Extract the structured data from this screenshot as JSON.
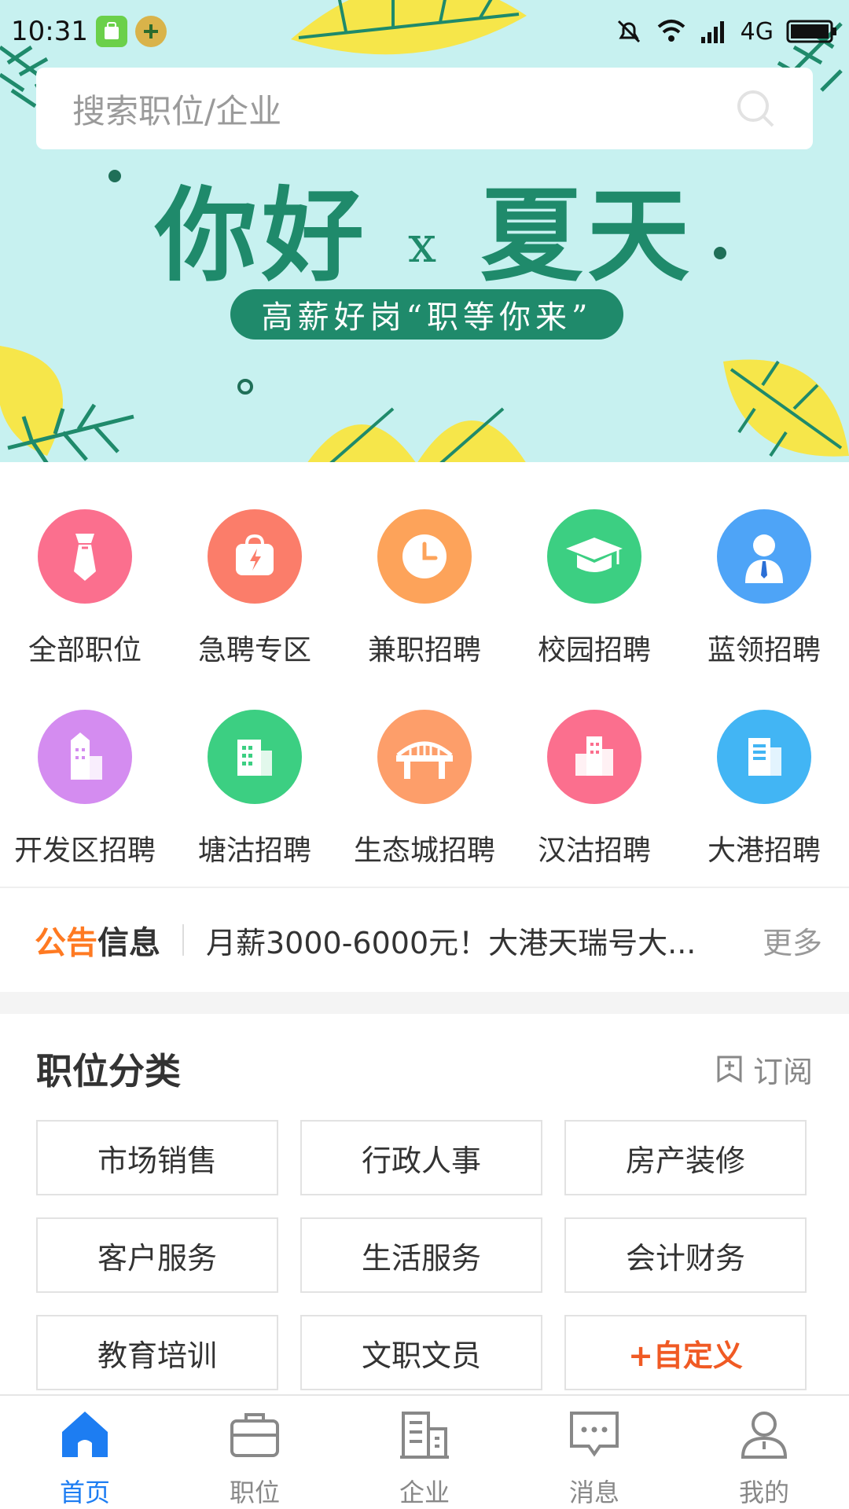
{
  "status_bar": {
    "time": "10:31",
    "network": "4G"
  },
  "search": {
    "placeholder": "搜索职位/企业"
  },
  "banner": {
    "title_left": "你好",
    "title_x": "x",
    "title_right": "夏天",
    "slogan": "高薪好岗“职等你来”"
  },
  "categories": [
    {
      "label": "全部职位",
      "icon": "tie-icon",
      "color": "#fb6f8e"
    },
    {
      "label": "急聘专区",
      "icon": "urgent-bag-icon",
      "color": "#fb7d6a"
    },
    {
      "label": "兼职招聘",
      "icon": "clock-icon",
      "color": "#fda35a"
    },
    {
      "label": "校园招聘",
      "icon": "graduation-cap-icon",
      "color": "#3ccf82"
    },
    {
      "label": "蓝领招聘",
      "icon": "worker-icon",
      "color": "#4ea4f7"
    },
    {
      "label": "开发区招聘",
      "icon": "tower-building-icon",
      "color": "#d48cf0"
    },
    {
      "label": "塘沽招聘",
      "icon": "building-icon",
      "color": "#3ccf82"
    },
    {
      "label": "生态城招聘",
      "icon": "bridge-icon",
      "color": "#fd9e6a"
    },
    {
      "label": "汉沽招聘",
      "icon": "city-building-icon",
      "color": "#fb6f8e"
    },
    {
      "label": "大港招聘",
      "icon": "office-icon",
      "color": "#42b5f4"
    }
  ],
  "notice": {
    "label_a": "公告",
    "label_b": "信息",
    "text": "月薪3000-6000元！大港天瑞号大...",
    "more": "更多"
  },
  "job_section": {
    "title": "职位分类",
    "subscribe": "订阅",
    "tags": [
      "市场销售",
      "行政人事",
      "房产装修",
      "客户服务",
      "生活服务",
      "会计财务",
      "教育培训",
      "文职文员",
      "+自定义"
    ]
  },
  "nav": [
    {
      "label": "首页",
      "icon": "home-icon"
    },
    {
      "label": "职位",
      "icon": "briefcase-icon"
    },
    {
      "label": "企业",
      "icon": "company-icon"
    },
    {
      "label": "消息",
      "icon": "message-icon"
    },
    {
      "label": "我的",
      "icon": "user-icon"
    }
  ],
  "colors": {
    "accent": "#1d7df2",
    "banner_bg": "#c7f1f0",
    "banner_green": "#1f8a6b",
    "notice_orange": "#ff7a22",
    "custom_red": "#f05a24"
  }
}
